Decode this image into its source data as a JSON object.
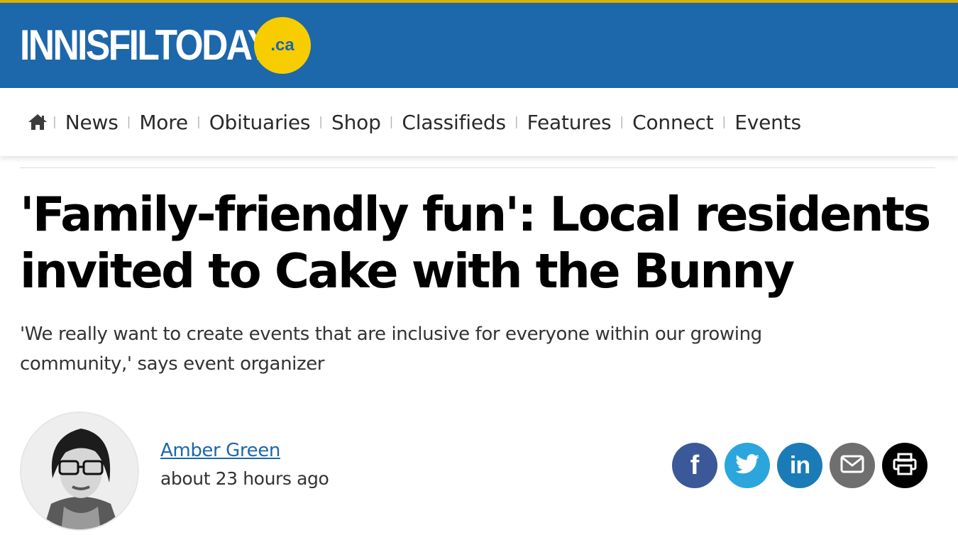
{
  "masthead": {
    "logo_text": "INNISFILTODAY",
    "logo_badge": ".ca",
    "brand_color": "#1d67ab",
    "badge_color": "#f7cd00"
  },
  "nav": {
    "home_icon": "home-icon",
    "items": [
      "News",
      "More",
      "Obituaries",
      "Shop",
      "Classifieds",
      "Features",
      "Connect",
      "Events"
    ]
  },
  "article": {
    "headline": "'Family-friendly fun': Local residents invited to Cake with the Bunny",
    "subhead": "'We really want to create events that are inclusive for everyone within our growing community,' says event organizer",
    "author": "Amber Green",
    "timestamp": "about 23 hours ago"
  },
  "share": {
    "buttons": [
      {
        "icon": "facebook-icon",
        "color": "#3b5998"
      },
      {
        "icon": "twitter-icon",
        "color": "#2aa6dd"
      },
      {
        "icon": "linkedin-icon",
        "color": "#1b7bb7"
      },
      {
        "icon": "email-icon",
        "color": "#6f6f6f"
      },
      {
        "icon": "print-icon",
        "color": "#000000"
      }
    ]
  }
}
